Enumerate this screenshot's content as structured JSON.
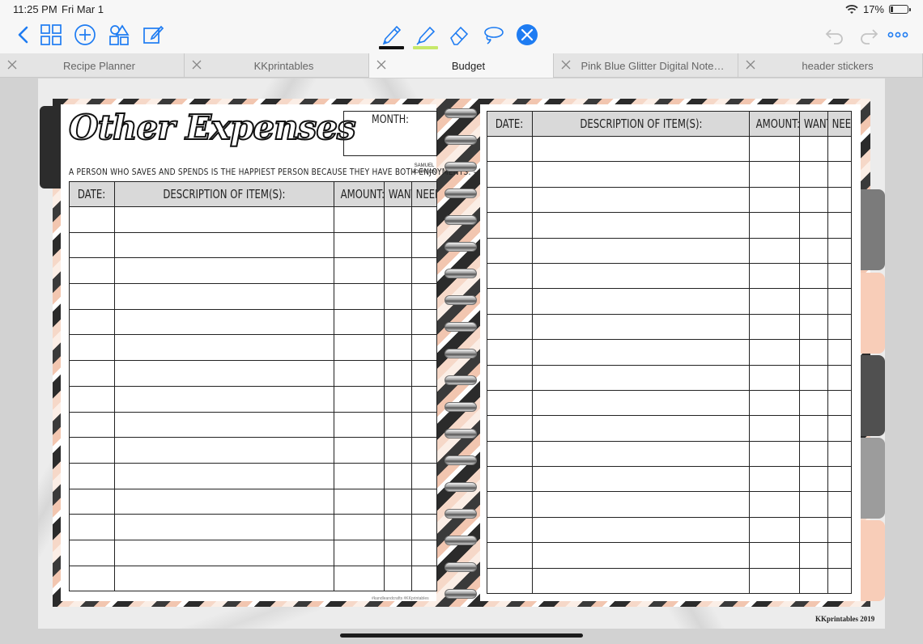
{
  "status_bar": {
    "time": "11:25 PM",
    "date": "Fri Mar 1",
    "battery": "17%",
    "battery_level": 0.17
  },
  "toolbar": {
    "icons": [
      "back-icon",
      "thumbnails-icon",
      "add-icon",
      "shapes-icon",
      "edit-icon",
      "pen-icon",
      "highlighter-icon",
      "eraser-icon",
      "lasso-icon",
      "close-tools-icon",
      "undo-icon",
      "redo-icon",
      "more-icon"
    ],
    "pen_color": "#111111",
    "highlighter_color": "#c7e86a",
    "accent": "#1e7cf2"
  },
  "tabs": [
    {
      "label": "Recipe Planner",
      "active": false
    },
    {
      "label": "KKprintables",
      "active": false
    },
    {
      "label": "Budget",
      "active": true
    },
    {
      "label": "Pink Blue Glitter Digital Notebook...",
      "active": false
    },
    {
      "label": "header stickers",
      "active": false
    }
  ],
  "planner": {
    "title": "Other Expenses",
    "month_label": "MONTH:",
    "quote": "A PERSON WHO SAVES AND SPENDS IS THE HAPPIEST PERSON BECAUSE THEY HAVE BOTH ENJOYMENTS. -",
    "quote_author": "SAMUEL JOHNSON",
    "columns": [
      "DATE:",
      "DESCRIPTION OF ITEM(S):",
      "AMOUNT:",
      "WANT",
      "NEED"
    ],
    "credit": "#kandleandcrafts #KKprintables",
    "watermark": "KKprintables 2019"
  }
}
